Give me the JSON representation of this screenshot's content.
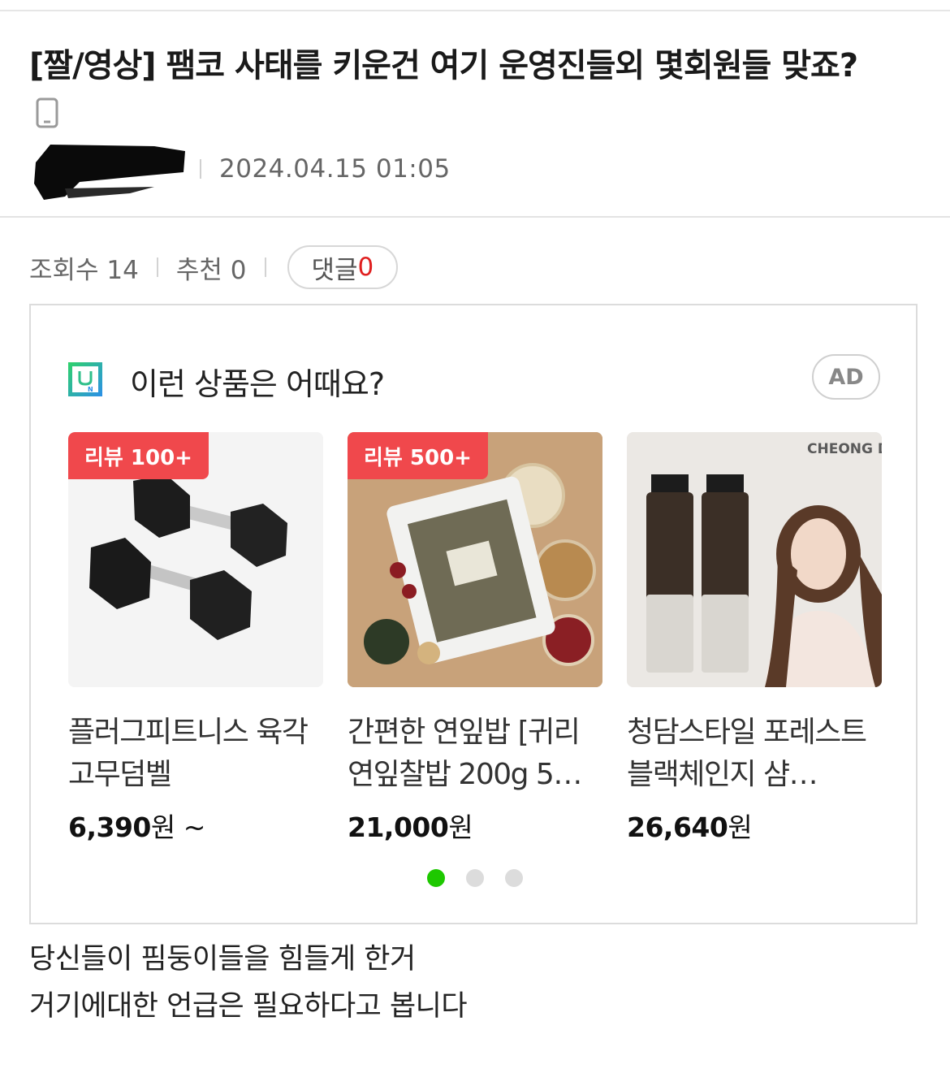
{
  "post": {
    "title": "[짤/영상] 팸코 사태를 키운건 여기 운영진들외 몇회원들 맞죠?",
    "device_icon": "mobile-phone-icon",
    "date": "2024.04.15 01:05",
    "stats": {
      "views_label": "조회수 14",
      "likes_label": "추천 0",
      "comments_label": "댓글",
      "comments_count": "0"
    },
    "body_lines": [
      "당신들이 핌둥이들을 힘들게 한거",
      "거기에대한 언급은 필요하다고 봅니다"
    ]
  },
  "ad": {
    "title": "이런 상품은 어때요?",
    "badge": "AD",
    "logo_icon": "shopping-bag-icon",
    "products": [
      {
        "tag": "리뷰 100+",
        "name": "플러그피트니스 육각 고무덤벨",
        "price": "6,390",
        "currency": "원",
        "suffix": " ~"
      },
      {
        "tag": "리뷰 500+",
        "name": "간편한 연잎밥 [귀리 연잎찰밥 200g 5…",
        "price": "21,000",
        "currency": "원",
        "suffix": ""
      },
      {
        "tag": "",
        "name": "청담스타일 포레스트 블랙체인지 샴…",
        "price": "26,640",
        "currency": "원",
        "suffix": "",
        "brand_text": "CHEONG DAM"
      }
    ],
    "pagination": {
      "total": 3,
      "active": 1
    }
  },
  "colors": {
    "accent_red": "#e02020",
    "review_tag": "#f0484c",
    "pager_active": "#1ec800"
  }
}
